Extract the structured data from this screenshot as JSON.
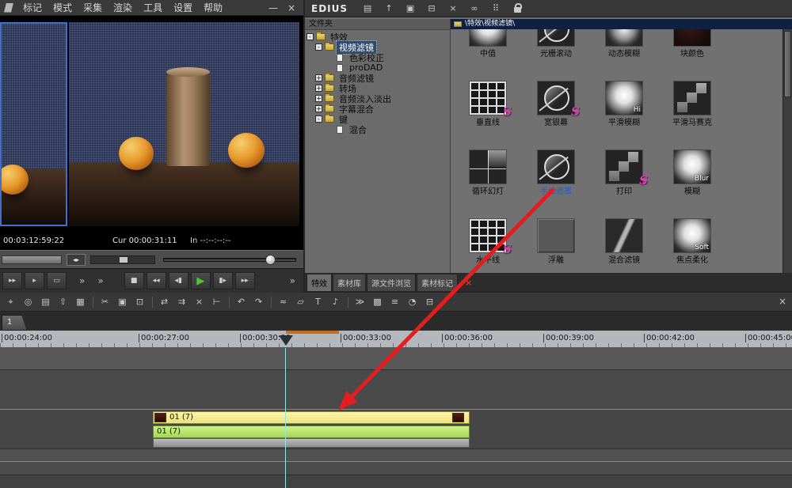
{
  "preview": {
    "menu": [
      "标记",
      "模式",
      "采集",
      "渲染",
      "工具",
      "设置",
      "帮助"
    ],
    "minimize_glyph": "—",
    "close_glyph": "×",
    "timecode_total": "00:03:12:59:22",
    "timecode_cur": "Cur 00:00:31:11",
    "timecode_in": "In --:--:--:--",
    "jog_glyph": "◂▸",
    "transport": [
      {
        "name": "fast-forward",
        "glyph": "▸▸"
      },
      {
        "name": "play-alt",
        "glyph": "▸"
      },
      {
        "name": "monitor",
        "glyph": "▭"
      },
      {
        "name": "more-1",
        "glyph": "»"
      },
      {
        "name": "more-2",
        "glyph": "»"
      },
      {
        "name": "stop",
        "glyph": "■"
      },
      {
        "name": "rewind",
        "glyph": "◂◂"
      },
      {
        "name": "prev-frame",
        "glyph": "◂▮"
      },
      {
        "name": "play",
        "glyph": "▶"
      },
      {
        "name": "next-frame",
        "glyph": "▮▸"
      },
      {
        "name": "fast-forward-2",
        "glyph": "▸▸"
      },
      {
        "name": "more-3",
        "glyph": "»"
      }
    ]
  },
  "bin": {
    "title": "EDIUS",
    "titlebar_icons": [
      {
        "name": "folder-icon",
        "glyph": "▤"
      },
      {
        "name": "up-level-icon",
        "glyph": "↑"
      },
      {
        "name": "layout-icon",
        "glyph": "▣"
      },
      {
        "name": "split-view-icon",
        "glyph": "⊟"
      },
      {
        "name": "close-icon",
        "glyph": "×"
      },
      {
        "name": "link-icon",
        "glyph": "∞"
      },
      {
        "name": "grid-view-icon",
        "glyph": "⠿"
      }
    ],
    "path": "\\特效\\视频滤镜\\",
    "tree_header": "文件夹",
    "tree": [
      {
        "label": "特效",
        "expander": "-"
      },
      {
        "label": "视频滤镜",
        "expander": "-"
      },
      {
        "label": "色彩校正"
      },
      {
        "label": "proDAD"
      },
      {
        "label": "音频滤镜",
        "expander": "+"
      },
      {
        "label": "转场",
        "expander": "+"
      },
      {
        "label": "音频淡入淡出",
        "expander": "+"
      },
      {
        "label": "字幕混合",
        "expander": "+"
      },
      {
        "label": "键",
        "expander": "-"
      },
      {
        "label": "混合"
      }
    ],
    "effects": [
      {
        "label": "中值"
      },
      {
        "label": "光栅滚动"
      },
      {
        "label": "动态模糊"
      },
      {
        "label": "块颜色"
      },
      {
        "label": "垂直线",
        "badge": "S"
      },
      {
        "label": "宽银幕",
        "badge": "S"
      },
      {
        "label": "平滑模糊",
        "overlay": "Hi"
      },
      {
        "label": "平滑马赛克"
      },
      {
        "label": "循环幻灯"
      },
      {
        "label": "手绘遮罩"
      },
      {
        "label": "打印",
        "badge": "S"
      },
      {
        "label": "模糊",
        "overlay": "Blur"
      },
      {
        "label": "水平线",
        "badge": "S"
      },
      {
        "label": "浮雕"
      },
      {
        "label": "混合滤镜"
      },
      {
        "label": "焦点柔化",
        "overlay": "Soft"
      }
    ],
    "tabs": [
      {
        "label": "特效"
      },
      {
        "label": "素材库"
      },
      {
        "label": "源文件浏览"
      },
      {
        "label": "素材标记"
      }
    ],
    "tab_close_glyph": "×"
  },
  "timeline": {
    "toolbar": [
      {
        "name": "select-tool-icon",
        "glyph": "⌖"
      },
      {
        "name": "snap-icon",
        "glyph": "◎"
      },
      {
        "name": "new-clip-icon",
        "glyph": "▤"
      },
      {
        "name": "export-icon",
        "glyph": "⇧"
      },
      {
        "name": "save-icon",
        "glyph": "▦"
      },
      {
        "name": "cut-icon",
        "glyph": "✂"
      },
      {
        "name": "copy-icon",
        "glyph": "▣"
      },
      {
        "name": "paste-icon",
        "glyph": "⊡"
      },
      {
        "name": "ripple-icon",
        "glyph": "⇄"
      },
      {
        "name": "overwrite-icon",
        "glyph": "⇉"
      },
      {
        "name": "delete-icon",
        "glyph": "×"
      },
      {
        "name": "trim-icon",
        "glyph": "⊢"
      },
      {
        "name": "undo-icon",
        "glyph": "↶"
      },
      {
        "name": "redo-icon",
        "glyph": "↷"
      },
      {
        "name": "fade-icon",
        "glyph": "≈"
      },
      {
        "name": "transition-icon",
        "glyph": "▱"
      },
      {
        "name": "title-icon",
        "glyph": "T"
      },
      {
        "name": "voiceover-icon",
        "glyph": "♪"
      },
      {
        "name": "sync-icon",
        "glyph": "≫"
      },
      {
        "name": "pattern-icon",
        "glyph": "▩"
      },
      {
        "name": "mixer-icon",
        "glyph": "≡"
      },
      {
        "name": "clock-icon",
        "glyph": "◔"
      },
      {
        "name": "list-icon",
        "glyph": "⊟"
      }
    ],
    "close_glyph": "×",
    "sequence_tab": "1",
    "ruler_ticks": [
      "00:00:24:00",
      "00:00:27:00",
      "00:00:30:00",
      "00:00:33:00",
      "00:00:36:00",
      "00:00:39:00",
      "00:00:42:00",
      "00:00:45:00"
    ],
    "clips": {
      "video_label": "01 (7)",
      "audio_label": "01 (7)"
    }
  },
  "colors": {
    "arrow_red": "#e51c20",
    "selection_blue": "#3f6fd0",
    "effect_selected_text": "#1f5fd6",
    "badge_pink": "#e838c0",
    "clip_yellow": "#f2eb96",
    "clip_green": "#b9e671",
    "play_green": "#53c437"
  }
}
